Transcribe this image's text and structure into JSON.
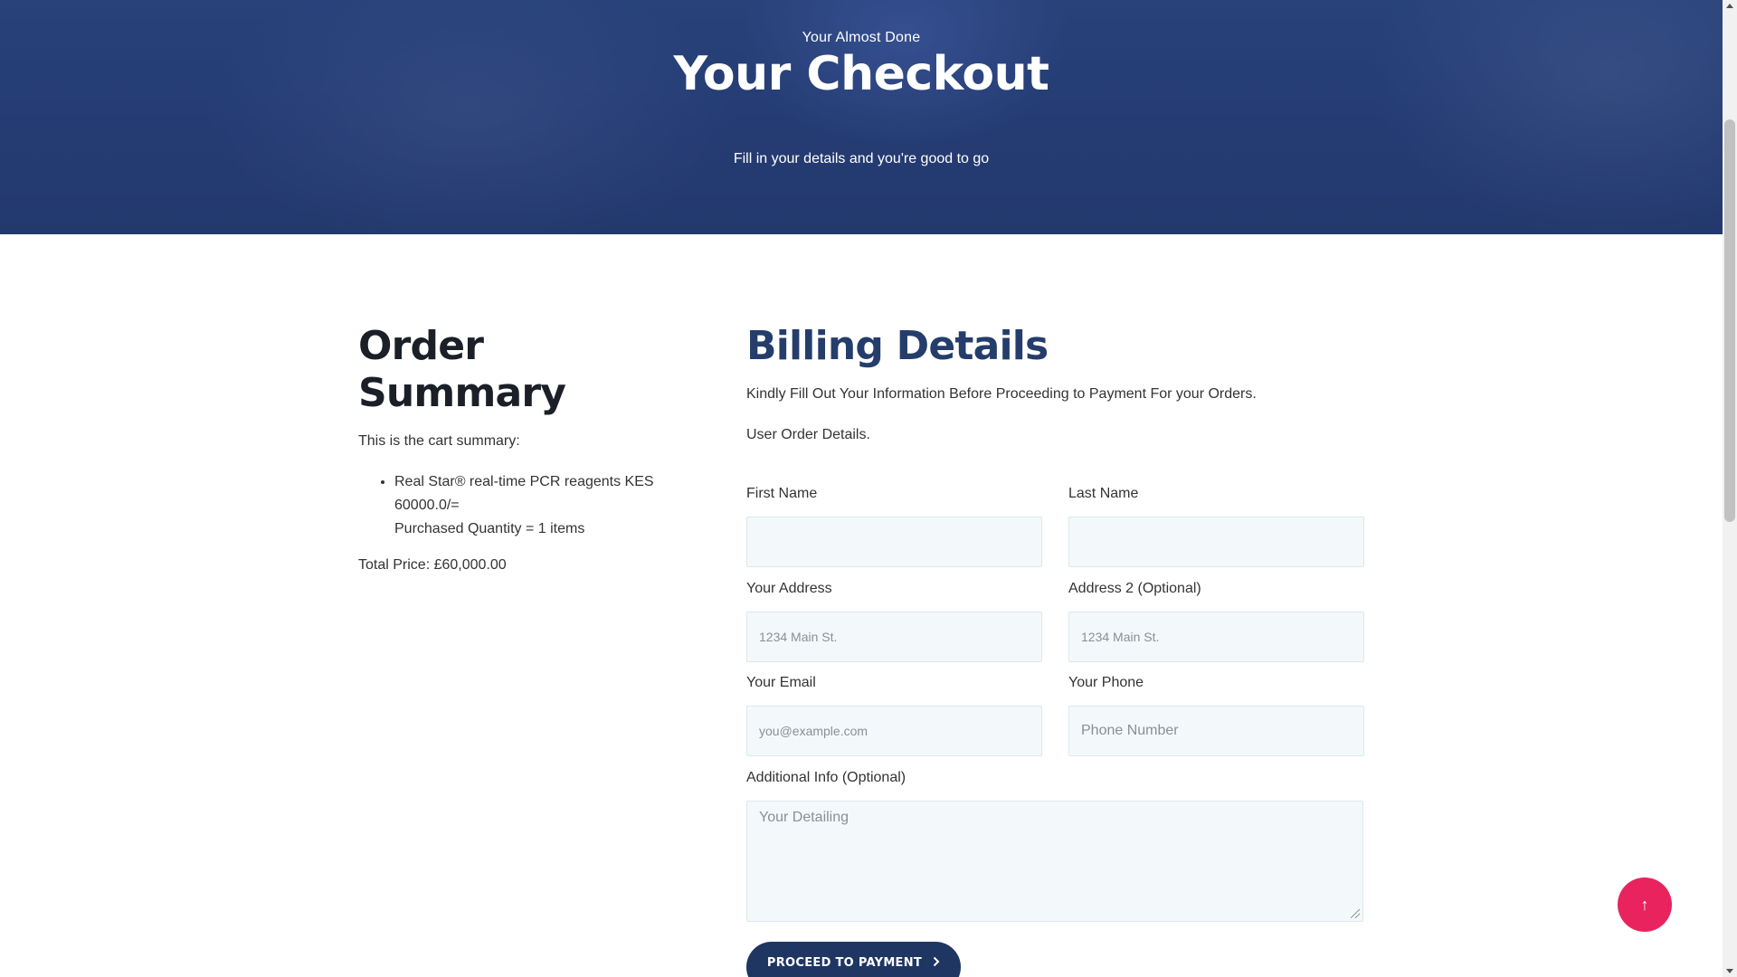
{
  "hero": {
    "eyebrow": "Your Almost Done",
    "title": "Your Checkout",
    "subtitle": "Fill in your details and you're good to go"
  },
  "order_summary": {
    "heading": "Order Summary",
    "intro": "This is the cart summary:",
    "items": [
      {
        "line": "Real Star® real-time PCR reagents KES 60000.0/=",
        "quantity": "Purchased Quantity = 1 items"
      }
    ],
    "total": "Total Price: £60,000.00"
  },
  "billing": {
    "heading": "Billing Details",
    "description": "Kindly Fill Out Your Information Before Proceeding to Payment For your Orders.",
    "order_details": "User Order Details.",
    "fields": {
      "first_name": {
        "label": "First Name",
        "value": "",
        "placeholder": ""
      },
      "last_name": {
        "label": "Last Name",
        "value": "",
        "placeholder": ""
      },
      "address": {
        "label": "Your Address",
        "value": "",
        "placeholder": "1234 Main St."
      },
      "address2": {
        "label": "Address 2 (Optional)",
        "value": "",
        "placeholder": "1234 Main St."
      },
      "email": {
        "label": "Your Email",
        "value": "",
        "placeholder": "you@example.com"
      },
      "phone": {
        "label": "Your Phone",
        "value": "",
        "placeholder": "Phone Number"
      },
      "additional": {
        "label": "Additional Info (Optional)",
        "value": "",
        "placeholder": "Your Detailing"
      }
    },
    "proceed_label": "PROCEED TO PAYMENT",
    "proceed_icon": "chevron-right-icon"
  },
  "back_to_top": {
    "icon": "arrow-up-icon",
    "glyph": "↑"
  },
  "colors": {
    "hero_bg": "#2e467d",
    "billing_heading": "#243d6b",
    "button_bg": "#1f3663",
    "back_to_top_bg": "#e8235e",
    "input_bg": "#f3f9fb"
  }
}
